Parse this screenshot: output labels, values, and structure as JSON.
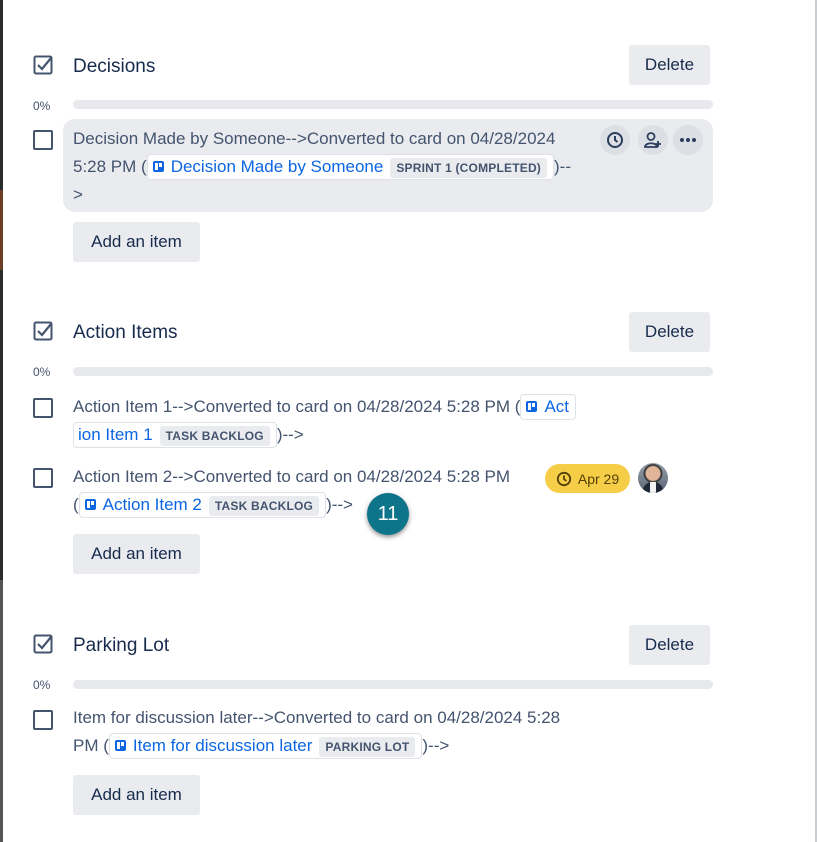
{
  "checklists": [
    {
      "title": "Decisions",
      "delete_label": "Delete",
      "progress_label": "0%",
      "progress": 0,
      "add_item_label": "Add an item",
      "items": [
        {
          "text_before": "Decision Made by Someone-->Converted to card on 04/28/2024",
          "text_before_line2": "5:28 PM (",
          "card_link": "Decision Made by Someone",
          "card_list": "SPRINT 1 (COMPLETED)",
          "text_after": ")--",
          "text_after_line3": ">"
        }
      ]
    },
    {
      "title": "Action Items",
      "delete_label": "Delete",
      "progress_label": "0%",
      "progress": 0,
      "add_item_label": "Add an item",
      "items": [
        {
          "text_before": "Action Item 1-->Converted to card on 04/28/2024 5:28 PM (",
          "card_link_part1": "Act",
          "card_link_part2": "ion Item 1",
          "card_list": "TASK BACKLOG",
          "text_after": ")-->"
        },
        {
          "text_before": "Action Item 2-->Converted to card on 04/28/2024 5:28 PM",
          "text_before_line2": "(",
          "card_link": "Action Item 2",
          "card_list": "TASK BACKLOG",
          "text_after": ")-->",
          "due_date": "Apr 29"
        }
      ]
    },
    {
      "title": "Parking Lot",
      "delete_label": "Delete",
      "progress_label": "0%",
      "progress": 0,
      "add_item_label": "Add an item",
      "items": [
        {
          "text_before": "Item for discussion later-->Converted to card on 04/28/2024 5:28",
          "text_before_line2": "PM (",
          "card_link": "Item for discussion later",
          "card_list": "PARKING LOT",
          "text_after": ")-->"
        }
      ]
    }
  ],
  "step_badge": "11",
  "colors": {
    "text": "#172b4d",
    "link": "#0c66e4",
    "due_badge": "#f5cd47",
    "step_badge": "#0e7489"
  }
}
